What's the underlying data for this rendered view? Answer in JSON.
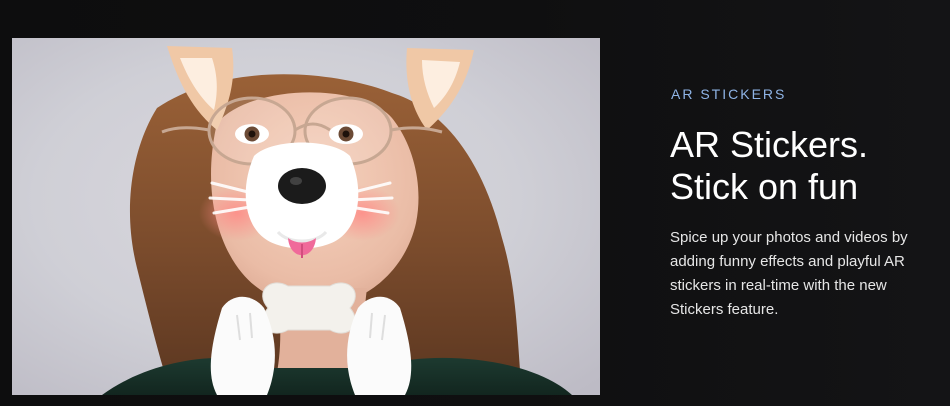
{
  "section": {
    "eyebrow": "AR STICKERS",
    "title": "AR Stickers. Stick on fun",
    "description": "Spice up your photos and videos by adding funny effects and playful AR stickers in real-time with the new Stickers feature."
  },
  "media": {
    "alt": "Woman wearing a dog-ear AR sticker filter holding a bone"
  },
  "colors": {
    "background": "#0d0d0e",
    "eyebrow_accent": "#8fb4e6",
    "title_text": "#ffffff",
    "body_text": "#e6e6e6"
  }
}
